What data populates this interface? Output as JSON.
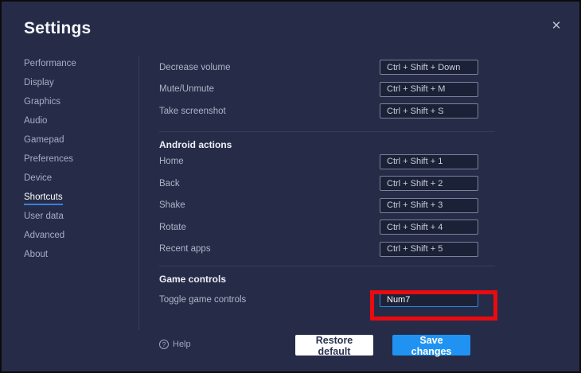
{
  "window": {
    "title": "Settings",
    "close_icon": "✕"
  },
  "colors": {
    "accent_underline": "#3b7fd9",
    "save_button_blue": "#2093f2",
    "focused_input_border": "#2f85e0",
    "highlight_red": "#ea0b0f",
    "background": "#262c48"
  },
  "sidebar": {
    "items": [
      {
        "label": "Performance",
        "active": false
      },
      {
        "label": "Display",
        "active": false
      },
      {
        "label": "Graphics",
        "active": false
      },
      {
        "label": "Audio",
        "active": false
      },
      {
        "label": "Gamepad",
        "active": false
      },
      {
        "label": "Preferences",
        "active": false
      },
      {
        "label": "Device",
        "active": false
      },
      {
        "label": "Shortcuts",
        "active": true
      },
      {
        "label": "User data",
        "active": false
      },
      {
        "label": "Advanced",
        "active": false
      },
      {
        "label": "About",
        "active": false
      }
    ]
  },
  "shortcuts": {
    "volume_rows": [
      {
        "label": "Decrease volume",
        "value": "Ctrl + Shift + Down"
      },
      {
        "label": "Mute/Unmute",
        "value": "Ctrl + Shift + M"
      },
      {
        "label": "Take screenshot",
        "value": "Ctrl + Shift + S"
      }
    ],
    "android": {
      "heading": "Android actions",
      "rows": [
        {
          "label": "Home",
          "value": "Ctrl + Shift + 1"
        },
        {
          "label": "Back",
          "value": "Ctrl + Shift + 2"
        },
        {
          "label": "Shake",
          "value": "Ctrl + Shift + 3"
        },
        {
          "label": "Rotate",
          "value": "Ctrl + Shift + 4"
        },
        {
          "label": "Recent apps",
          "value": "Ctrl + Shift + 5"
        }
      ]
    },
    "game": {
      "heading": "Game controls",
      "rows": [
        {
          "label": "Toggle game controls",
          "value": "Num7",
          "focused": true
        }
      ]
    }
  },
  "footer": {
    "help_icon": "?",
    "help_label": "Help",
    "restore_label": "Restore default",
    "save_label": "Save changes"
  }
}
